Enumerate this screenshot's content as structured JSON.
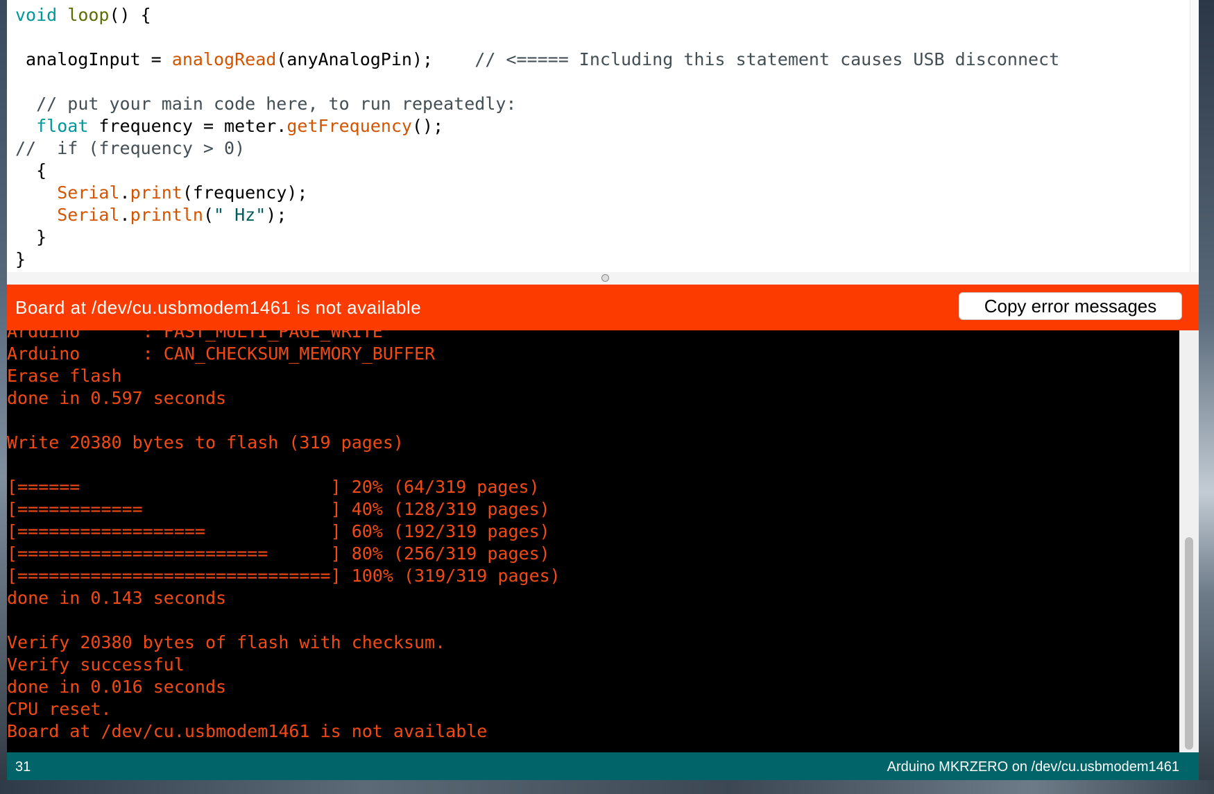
{
  "editor": {
    "lines": [
      [
        {
          "t": "void",
          "c": "kw"
        },
        {
          "t": " "
        },
        {
          "t": "loop",
          "c": "fn"
        },
        {
          "t": "() {"
        }
      ],
      [
        {
          "t": ""
        }
      ],
      [
        {
          "t": " analogInput = "
        },
        {
          "t": "analogRead",
          "c": "orange"
        },
        {
          "t": "(anyAnalogPin);    "
        },
        {
          "t": "// <===== Including this statement causes USB disconnect",
          "c": "cm"
        }
      ],
      [
        {
          "t": ""
        }
      ],
      [
        {
          "t": "  "
        },
        {
          "t": "// put your main code here, to run repeatedly:",
          "c": "cm"
        }
      ],
      [
        {
          "t": "  "
        },
        {
          "t": "float",
          "c": "kw"
        },
        {
          "t": " frequency = meter."
        },
        {
          "t": "getFrequency",
          "c": "orange"
        },
        {
          "t": "();"
        }
      ],
      [
        {
          "t": "//  if (frequency > 0)",
          "c": "cm"
        }
      ],
      [
        {
          "t": "  {"
        }
      ],
      [
        {
          "t": "    "
        },
        {
          "t": "Serial",
          "c": "orange"
        },
        {
          "t": "."
        },
        {
          "t": "print",
          "c": "orange"
        },
        {
          "t": "(frequency);"
        }
      ],
      [
        {
          "t": "    "
        },
        {
          "t": "Serial",
          "c": "orange"
        },
        {
          "t": "."
        },
        {
          "t": "println",
          "c": "orange"
        },
        {
          "t": "("
        },
        {
          "t": "\" Hz\"",
          "c": "str"
        },
        {
          "t": ");"
        }
      ],
      [
        {
          "t": "  }"
        }
      ],
      [
        {
          "t": "}"
        }
      ]
    ]
  },
  "error_bar": {
    "message": "Board at /dev/cu.usbmodem1461 is not available",
    "copy_button_label": "Copy error messages"
  },
  "console": {
    "lines": [
      "Arduino      : FAST_MULTI_PAGE_WRITE",
      "Arduino      : CAN_CHECKSUM_MEMORY_BUFFER",
      "Erase flash",
      "done in 0.597 seconds",
      "",
      "Write 20380 bytes to flash (319 pages)",
      "",
      "[======                        ] 20% (64/319 pages)",
      "[============                  ] 40% (128/319 pages)",
      "[==================            ] 60% (192/319 pages)",
      "[========================      ] 80% (256/319 pages)",
      "[==============================] 100% (319/319 pages)",
      "done in 0.143 seconds",
      "",
      "Verify 20380 bytes of flash with checksum.",
      "Verify successful",
      "done in 0.016 seconds",
      "CPU reset.",
      "Board at /dev/cu.usbmodem1461 is not available"
    ]
  },
  "status_bar": {
    "line_number": "31",
    "board_info": "Arduino MKRZERO on /dev/cu.usbmodem1461"
  },
  "colors": {
    "error_bar": "#fc3b00",
    "status_bar": "#006468",
    "console_text": "#f14a14",
    "keyword": "#00979c",
    "function": "#d35400"
  }
}
